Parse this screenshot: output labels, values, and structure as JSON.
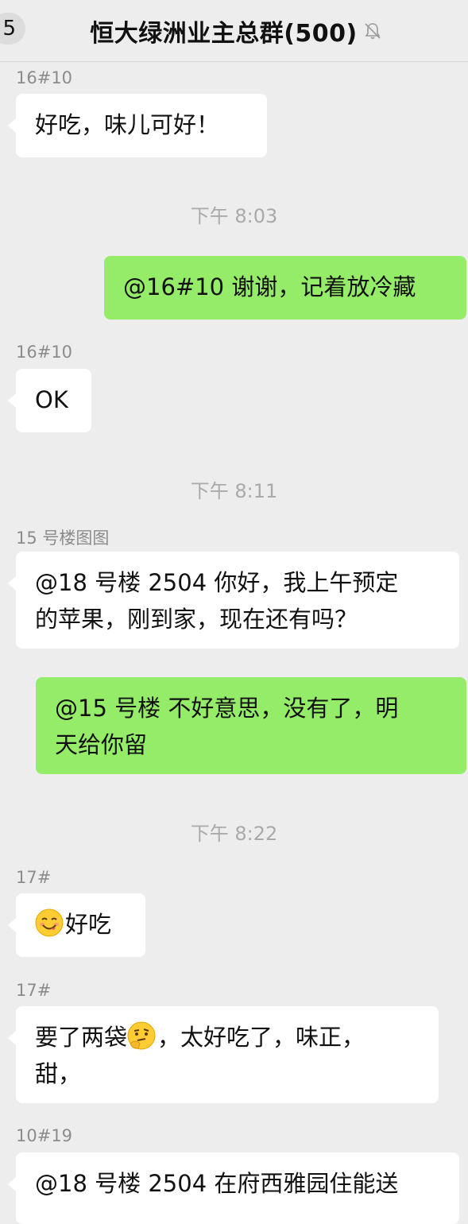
{
  "header": {
    "back_badge": "5",
    "title": "恒大绿洲业主总群(500)",
    "mute_icon": "bell-muted-icon"
  },
  "messages": [
    {
      "type": "incoming",
      "sender": "16#10",
      "text": "好吃，味儿可好！"
    },
    {
      "type": "time",
      "text": "下午 8:03"
    },
    {
      "type": "outgoing",
      "text": "@16#10 谢谢，记着放冷藏"
    },
    {
      "type": "incoming",
      "sender": "16#10",
      "text": "OK"
    },
    {
      "type": "time",
      "text": "下午 8:11"
    },
    {
      "type": "incoming",
      "sender": "15 号楼图图",
      "line1": "@18 号楼 2504 你好，我上午预定",
      "line2": "的苹果，刚到家，现在还有吗？"
    },
    {
      "type": "outgoing",
      "line1": "@15 号楼 不好意思，没有了，明",
      "line2": "天给你留"
    },
    {
      "type": "time",
      "text": "下午 8:22"
    },
    {
      "type": "incoming",
      "sender": "17#",
      "emoji": "yum-face-emoji",
      "text": "好吃"
    },
    {
      "type": "incoming",
      "sender": "17#",
      "before_emoji": "要了两袋",
      "emoji": "thinking-face-emoji",
      "after_emoji": "，太好吃了，味正，",
      "line2": "甜，"
    },
    {
      "type": "incoming",
      "sender": "10#19",
      "text": "@18 号楼 2504 在府西雅园住能送"
    }
  ]
}
